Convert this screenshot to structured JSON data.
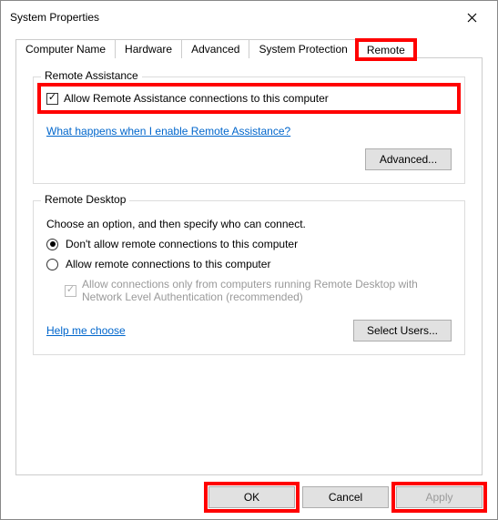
{
  "title": "System Properties",
  "tabs": {
    "computer_name": "Computer Name",
    "hardware": "Hardware",
    "advanced": "Advanced",
    "system_protection": "System Protection",
    "remote": "Remote"
  },
  "remote_assistance": {
    "group_label": "Remote Assistance",
    "allow_label": "Allow Remote Assistance connections to this computer",
    "allow_checked": true,
    "help_link": "What happens when I enable Remote Assistance?",
    "advanced_btn": "Advanced..."
  },
  "remote_desktop": {
    "group_label": "Remote Desktop",
    "desc": "Choose an option, and then specify who can connect.",
    "option_dont_allow": "Don't allow remote connections to this computer",
    "option_allow": "Allow remote connections to this computer",
    "nla_label": "Allow connections only from computers running Remote Desktop with Network Level Authentication (recommended)",
    "help_link": "Help me choose",
    "select_users_btn": "Select Users..."
  },
  "buttons": {
    "ok": "OK",
    "cancel": "Cancel",
    "apply": "Apply"
  }
}
